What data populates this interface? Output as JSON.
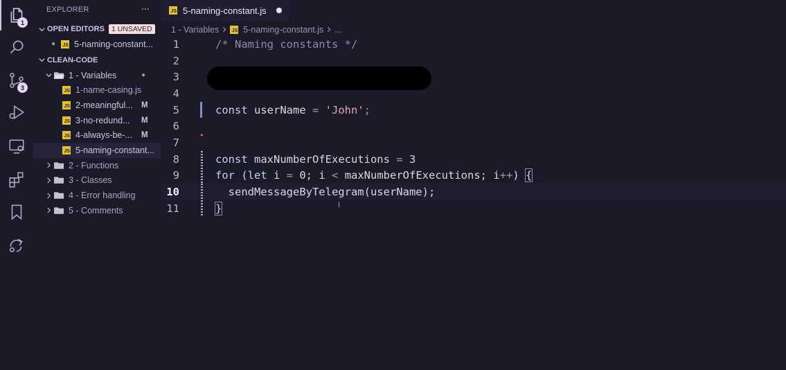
{
  "activity_bar": {
    "explorer_badge": "1",
    "source_control_badge": "3"
  },
  "sidebar": {
    "title": "EXPLORER",
    "more": "···",
    "open_editors": {
      "label": "OPEN EDITORS",
      "badge": "1 UNSAVED",
      "items": [
        {
          "name": "5-naming-constant..."
        }
      ]
    },
    "workspace": {
      "label": "CLEAN-CODE",
      "folder_open": "1 - Variables",
      "files": [
        {
          "name": "1-name-casing.js",
          "flag": ""
        },
        {
          "name": "2-meaningful...",
          "flag": "M"
        },
        {
          "name": "3-no-redund...",
          "flag": "M"
        },
        {
          "name": "4-always-be-...",
          "flag": "M"
        },
        {
          "name": "5-naming-constant...",
          "flag": ""
        }
      ],
      "folders": [
        "2 - Functions",
        "3 - Classes",
        "4 - Error handling",
        "5 - Comments"
      ]
    }
  },
  "editor": {
    "tab_label": "5-naming-constant.js",
    "breadcrumb": {
      "folder": "1 - Variables",
      "file": "5-naming-constant.js",
      "rest": "..."
    },
    "line_numbers": [
      "1",
      "2",
      "3",
      "4",
      "5",
      "6",
      "7",
      "8",
      "9",
      "10",
      "11"
    ],
    "code": {
      "l1": "/* Naming constants */",
      "l5_kw": "const",
      "l5_name": " userName ",
      "l5_eq": "=",
      "l5_str": " 'John'",
      "l5_end": ";",
      "l8_kw": "const",
      "l8_name": " maxNumberOfExecutions ",
      "l8_eq": "=",
      "l8_num": " 3",
      "l9_a": "for (",
      "l9_let": "let",
      "l9_b": " i ",
      "l9_eq": "=",
      "l9_c": " 0; i ",
      "l9_lt": "<",
      "l9_d": " maxNumberOfExecutions; i",
      "l9_inc": "++",
      "l9_e": ") ",
      "l9_brace": "{",
      "l10": "  sendMessageByTelegram(userName);",
      "l11": "}"
    }
  }
}
